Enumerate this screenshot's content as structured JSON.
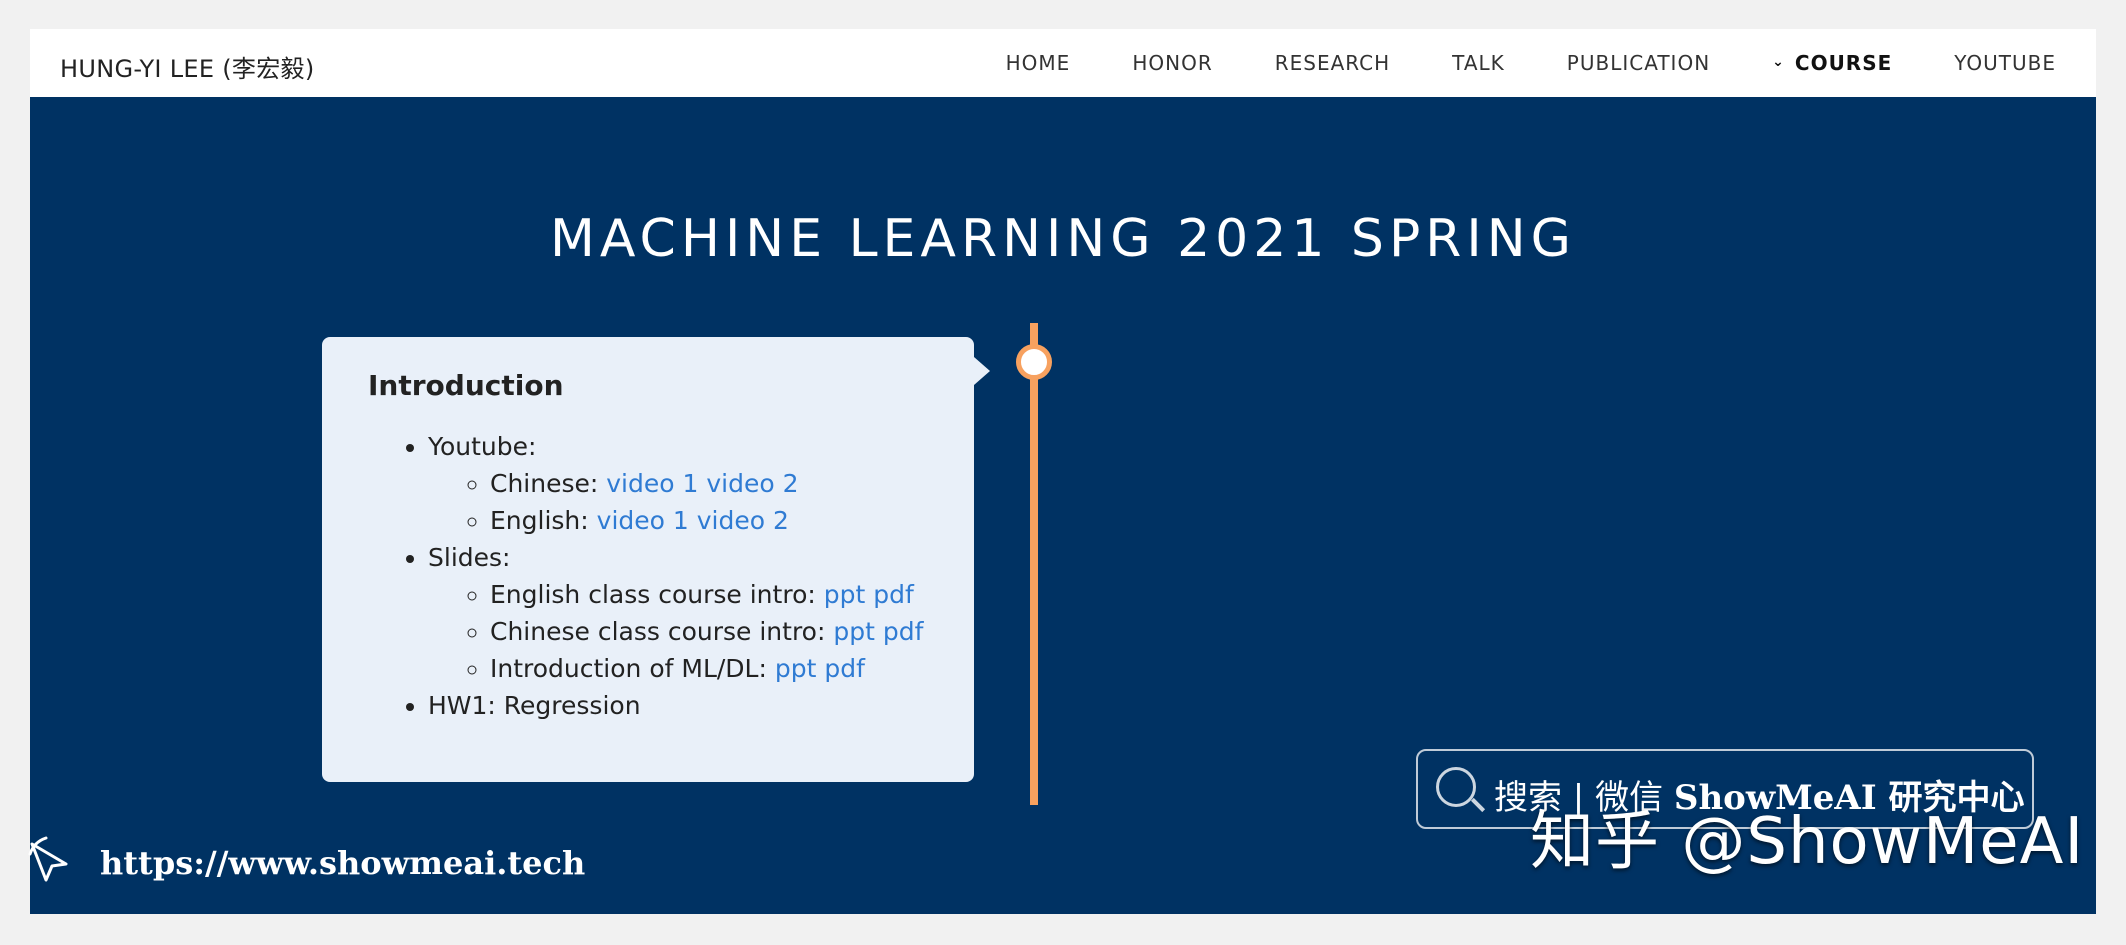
{
  "brand": "HUNG-YI LEE (李宏毅)",
  "nav": [
    {
      "label": "HOME",
      "active": false
    },
    {
      "label": "HONOR",
      "active": false
    },
    {
      "label": "RESEARCH",
      "active": false
    },
    {
      "label": "TALK",
      "active": false
    },
    {
      "label": "PUBLICATION",
      "active": false
    },
    {
      "label": "COURSE",
      "active": true
    },
    {
      "label": "YOUTUBE",
      "active": false
    }
  ],
  "page_title": "MACHINE LEARNING 2021 SPRING",
  "card": {
    "heading": "Introduction",
    "youtube_label": "Youtube:",
    "chinese_label": "Chinese:",
    "chinese_video1": "video 1",
    "chinese_video2": "video 2",
    "english_label": "English:",
    "english_video1": "video 1",
    "english_video2": "video 2",
    "slides_label": "Slides:",
    "eng_intro_label": "English class course intro:",
    "chi_intro_label": "Chinese class course intro:",
    "mldl_label": "Introduction of ML/DL:",
    "ppt": "ppt",
    "pdf": "pdf",
    "hw1": "HW1: Regression"
  },
  "watermark": {
    "search_text": "搜索 | 微信",
    "search_bold": "ShowMeAI 研究中心",
    "zhihu": "知乎 @ShowMeAI",
    "url": "https://www.showmeai.tech"
  },
  "colors": {
    "hero_bg": "#003263",
    "timeline": "#f7a15f",
    "card_bg": "#e9f0f9",
    "link": "#2f7bd3"
  }
}
